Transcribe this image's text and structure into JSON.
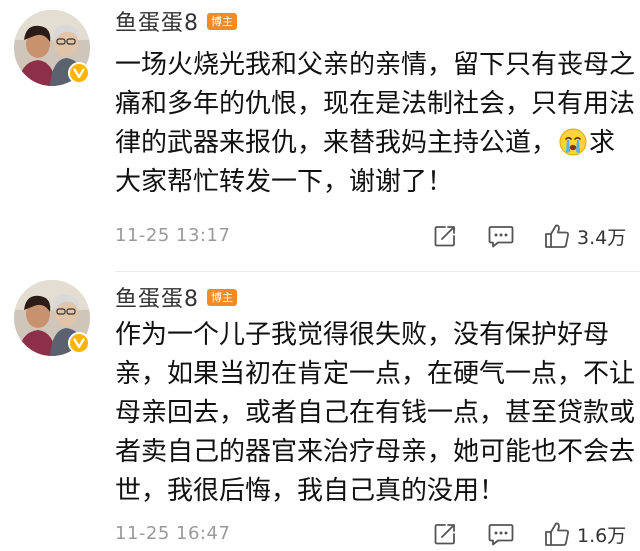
{
  "comments": [
    {
      "username": "鱼蛋蛋8",
      "badge": "博主",
      "lines": [
        "一场火烧光我和父亲的亲情，留下只有丧母之",
        "痛和多年的仇恨，现在是法制社会，只有用法",
        "律的武器来报仇，来替我妈主持公道，",
        "求",
        "大家帮忙转发一下，谢谢了！"
      ],
      "emoji": "crying-emoji",
      "timestamp": "11-25 13:17",
      "like_count": "3.4万"
    },
    {
      "username": "鱼蛋蛋8",
      "badge": "博主",
      "lines": [
        "作为一个儿子我觉得很失败，没有保护好母",
        "亲，如果当初在肯定一点，在硬气一点，不让",
        "母亲回去，或者自己在有钱一点，甚至贷款或",
        "者卖自己的器官来治疗母亲，她可能也不会去",
        "世，我很后悔，我自己真的没用！"
      ],
      "timestamp": "11-25 16:47",
      "like_count": "1.6万"
    }
  ],
  "icons": {
    "share": "share-icon",
    "comment": "comment-icon",
    "like": "thumbs-up-icon",
    "verified": "verified-v-icon"
  },
  "colors": {
    "badge": "#f28b24",
    "verified": "#ffb400",
    "meta_text": "#9a9a9a",
    "icon_stroke": "#555555"
  }
}
